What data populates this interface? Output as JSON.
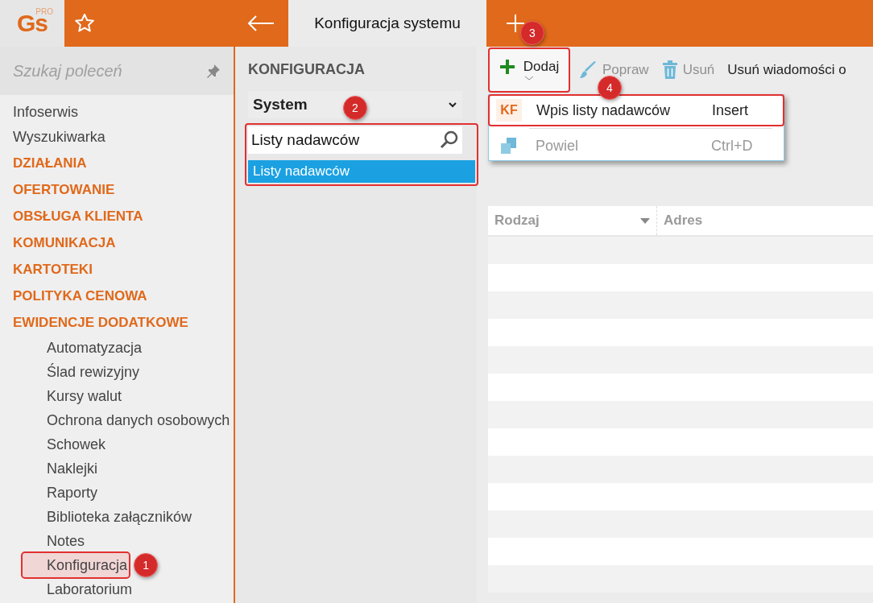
{
  "logo": {
    "mark": "Gs",
    "edition": "PRO"
  },
  "tabs": [
    {
      "label": "Konfiguracja systemu",
      "selected": true
    }
  ],
  "sidebar": {
    "search": {
      "placeholder": "Szukaj poleceń"
    },
    "items": [
      {
        "label": "Infoserwis",
        "kind": "link",
        "selected": false
      },
      {
        "label": "Wyszukiwarka",
        "kind": "link",
        "selected": false
      },
      {
        "label": "DZIAŁANIA",
        "kind": "section",
        "selected": false
      },
      {
        "label": "OFERTOWANIE",
        "kind": "section",
        "selected": false
      },
      {
        "label": "OBSŁUGA KLIENTA",
        "kind": "section",
        "selected": false
      },
      {
        "label": "KOMUNIKACJA",
        "kind": "section",
        "selected": false
      },
      {
        "label": "KARTOTEKI",
        "kind": "section",
        "selected": false
      },
      {
        "label": "POLITYKA CENOWA",
        "kind": "section",
        "selected": false
      },
      {
        "label": "EWIDENCJE DODATKOWE",
        "kind": "section",
        "selected": false,
        "children": [
          {
            "label": "Automatyzacja",
            "selected": false
          },
          {
            "label": "Ślad rewizyjny",
            "selected": false
          },
          {
            "label": "Kursy walut",
            "selected": false
          },
          {
            "label": "Ochrona danych osobowych",
            "selected": false
          },
          {
            "label": "Schowek",
            "selected": false
          },
          {
            "label": "Naklejki",
            "selected": false
          },
          {
            "label": "Raporty",
            "selected": false
          },
          {
            "label": "Biblioteka załączników",
            "selected": false
          },
          {
            "label": "Notes",
            "selected": false
          },
          {
            "label": "Konfiguracja",
            "selected": true,
            "callout": "1"
          },
          {
            "label": "Laboratorium",
            "selected": false
          }
        ]
      }
    ]
  },
  "config_panel": {
    "title": "KONFIGURACJA",
    "category": "System",
    "callout": "2",
    "filter": {
      "value": "Listy nadawców"
    },
    "results": [
      {
        "label": "Listy nadawców",
        "selected": true
      }
    ]
  },
  "new_tab_callout": "3",
  "toolbar": [
    {
      "label": "Dodaj",
      "kind": "add",
      "disabled": false
    },
    {
      "label": "Popraw",
      "kind": "edit",
      "disabled": true
    },
    {
      "label": "Usuń",
      "kind": "delete",
      "disabled": true
    },
    {
      "label": "Usuń wiadomości o",
      "kind": "text",
      "disabled": false
    }
  ],
  "add_menu": {
    "callout": "4",
    "items": [
      {
        "label": "Wpis listy nadawców",
        "shortcut": "Insert",
        "kind": "entry",
        "icon_text": "KF",
        "disabled": false,
        "highlighted": true
      },
      {
        "label": "Powiel",
        "shortcut": "Ctrl+D",
        "kind": "duplicate",
        "disabled": true,
        "highlighted": false
      }
    ]
  },
  "table": {
    "columns": [
      {
        "label": "Rodzaj",
        "sortable": true
      },
      {
        "label": "Adres",
        "sortable": false
      }
    ]
  }
}
